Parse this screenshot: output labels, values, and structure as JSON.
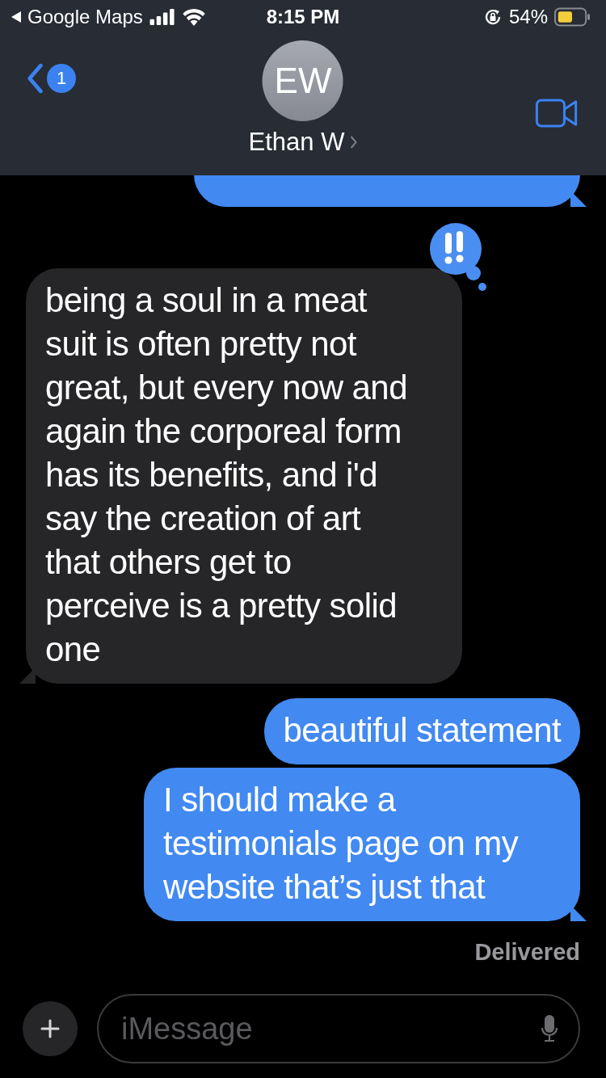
{
  "status_bar": {
    "back_app": "Google Maps",
    "time": "8:15 PM",
    "battery": "54%"
  },
  "header": {
    "back_badge": "1",
    "avatar_initials": "EW",
    "contact_name": "Ethan W"
  },
  "messages": [
    {
      "kind": "sent",
      "tail": true
    },
    {
      "kind": "received",
      "text": "being a soul in a meat suit is often pretty not great, but every now and again the corporeal form has its benefits, and i'd say the creation of art that others get to perceive is a pretty solid one",
      "tail": true,
      "emphasized": true
    },
    {
      "kind": "sent",
      "text": "beautiful statement",
      "tail": false
    },
    {
      "kind": "sent",
      "text": "I should make a testimonials page on my website that’s just that",
      "tail": true
    }
  ],
  "receipt": "Delivered",
  "compose": {
    "placeholder": "iMessage"
  }
}
